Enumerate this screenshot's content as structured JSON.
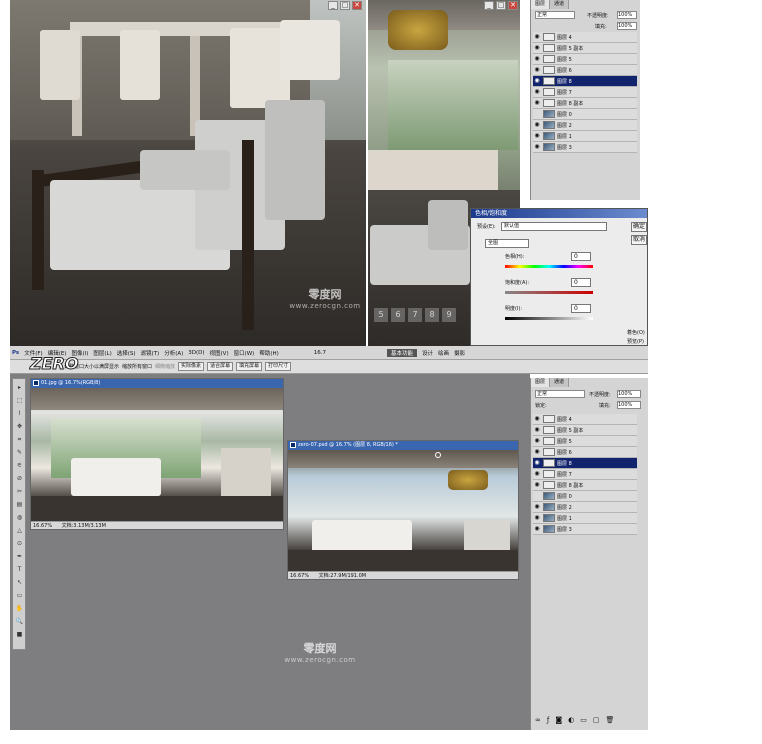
{
  "top_photo": {
    "watermark": "零度网",
    "watermark_url": "www.zerocgn.com",
    "window_buttons": [
      "_",
      "□",
      "✕"
    ]
  },
  "top_right_photo": {
    "page_numbers": [
      "5",
      "6",
      "7",
      "8",
      "9"
    ],
    "window_buttons": [
      "_",
      "□",
      "✕"
    ]
  },
  "layers_top": {
    "tabs": [
      "图层",
      "通道"
    ],
    "blend_mode": "正常",
    "opacity_label": "不透明度:",
    "opacity_value": "100%",
    "fill_label": "填充:",
    "fill_value": "100%",
    "rows": [
      {
        "name": "图层 4",
        "visible": true
      },
      {
        "name": "图层 5 副本",
        "visible": true
      },
      {
        "name": "图层 5",
        "visible": true
      },
      {
        "name": "图层 6",
        "visible": true
      },
      {
        "name": "图层 8",
        "visible": true,
        "selected": true
      },
      {
        "name": "图层 7",
        "visible": true
      },
      {
        "name": "图层 8 副本",
        "visible": true
      },
      {
        "name": "图层 0",
        "visible": false
      },
      {
        "name": "图层 2",
        "visible": true
      },
      {
        "name": "图层 1",
        "visible": true
      },
      {
        "name": "图层 3",
        "visible": true
      }
    ]
  },
  "hue_dialog": {
    "title": "色相/饱和度",
    "preset_label": "预设(E):",
    "preset_value": "默认值",
    "channel": "全图",
    "hue_label": "色相(H):",
    "hue_value": "0",
    "sat_label": "饱和度(A):",
    "sat_value": "0",
    "light_label": "明度(I):",
    "light_value": "0",
    "ok_label": "确定",
    "cancel_label": "取消",
    "colorize_label": "着色(O)",
    "preview_label": "预览(P)"
  },
  "menubar": {
    "ps_label": "Ps",
    "items": [
      "文件(F)",
      "编辑(E)",
      "图像(I)",
      "图层(L)",
      "选择(S)",
      "滤镜(T)",
      "分析(A)",
      "3D(D)",
      "视图(V)",
      "窗口(W)",
      "帮助(H)"
    ],
    "zoom": "16.7",
    "workspace_label": "基本功能",
    "workspace_items": [
      "设计",
      "绘画",
      "摄影"
    ]
  },
  "optbar": {
    "resize_label": "调整窗口大小以满屏显示",
    "all_windows_label": "缩放所有窗口",
    "scrubby_label": "细微缩放",
    "actual_pixels": "实际像素",
    "fit_screen": "适合屏幕",
    "fill_screen": "填充屏幕",
    "print_size": "打印尺寸"
  },
  "doc1": {
    "title": "01.jpg @ 16.7%(RGB/8)",
    "zoom": "16.67%",
    "status": "文档:3.13M/3.13M"
  },
  "doc2": {
    "title": "zero-07.psd @ 16.7% (图层 8, RGB/16) *",
    "zoom": "16.67%",
    "status": "文档:27.9M/191.0M"
  },
  "workspace_watermark": {
    "text": "零度网",
    "url": "www.zerocgn.com"
  },
  "zero_logo": "ZERO",
  "layers_bottom": {
    "tabs": [
      "图层",
      "通道"
    ],
    "blend_mode": "正常",
    "opacity_label": "不透明度:",
    "opacity_value": "100%",
    "lock_label": "锁定:",
    "fill_label": "填充:",
    "fill_value": "100%",
    "rows": [
      {
        "name": "图层 4",
        "visible": true
      },
      {
        "name": "图层 5 副本",
        "visible": true
      },
      {
        "name": "图层 5",
        "visible": true
      },
      {
        "name": "图层 6",
        "visible": true
      },
      {
        "name": "图层 8",
        "visible": true,
        "selected": true
      },
      {
        "name": "图层 7",
        "visible": true
      },
      {
        "name": "图层 8 副本",
        "visible": true
      },
      {
        "name": "图层 0",
        "visible": false
      },
      {
        "name": "图层 2",
        "visible": true
      },
      {
        "name": "图层 1",
        "visible": true
      },
      {
        "name": "图层 3",
        "visible": true
      }
    ]
  }
}
